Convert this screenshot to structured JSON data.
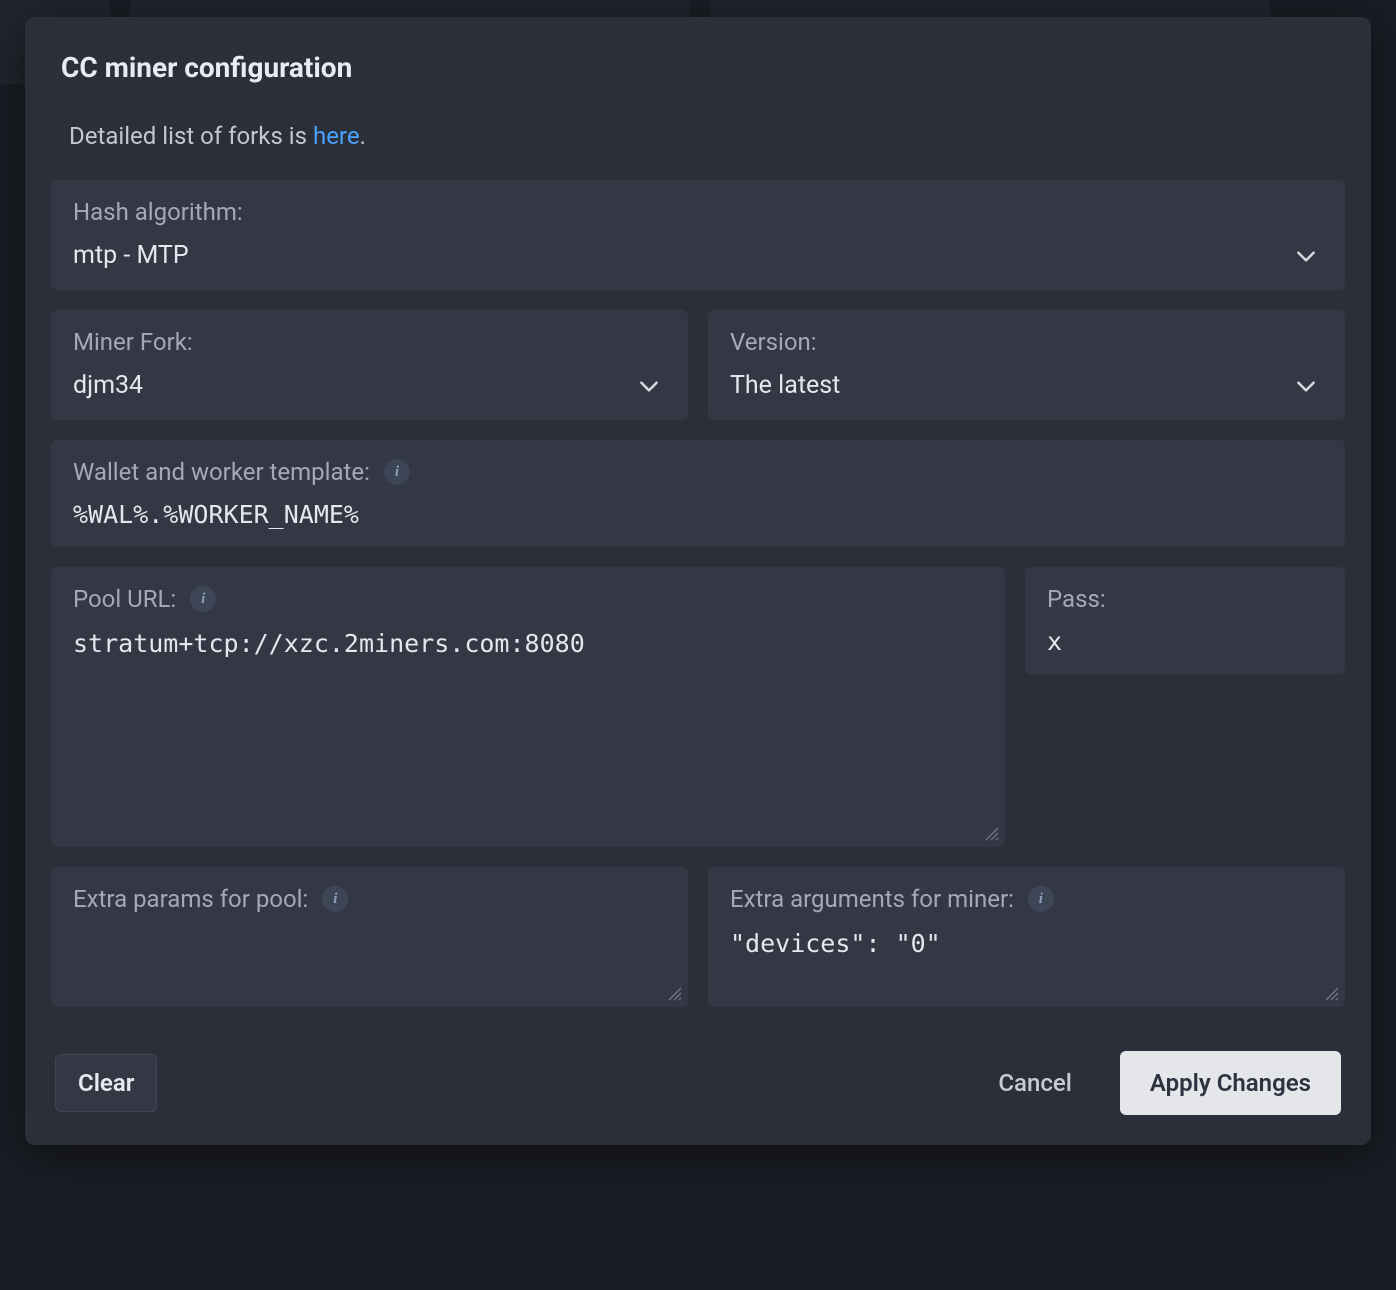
{
  "modal": {
    "title": "CC miner configuration",
    "intro_prefix": "Detailed list of forks is ",
    "intro_link": "here",
    "intro_suffix": "."
  },
  "fields": {
    "hash_algorithm": {
      "label": "Hash algorithm:",
      "value": "mtp - MTP"
    },
    "miner_fork": {
      "label": "Miner Fork:",
      "value": "djm34"
    },
    "version": {
      "label": "Version:",
      "value": "The latest"
    },
    "wallet_template": {
      "label": "Wallet and worker template:",
      "value": "%WAL%.%WORKER_NAME%"
    },
    "pool_url": {
      "label": "Pool URL:",
      "value": "stratum+tcp://xzc.2miners.com:8080"
    },
    "pass": {
      "label": "Pass:",
      "value": "x"
    },
    "extra_pool": {
      "label": "Extra params for pool:",
      "value": ""
    },
    "extra_miner": {
      "label": "Extra arguments for miner:",
      "value": "\"devices\": \"0\""
    }
  },
  "buttons": {
    "clear": "Clear",
    "cancel": "Cancel",
    "apply": "Apply Changes"
  },
  "icons": {
    "info_glyph": "i"
  }
}
